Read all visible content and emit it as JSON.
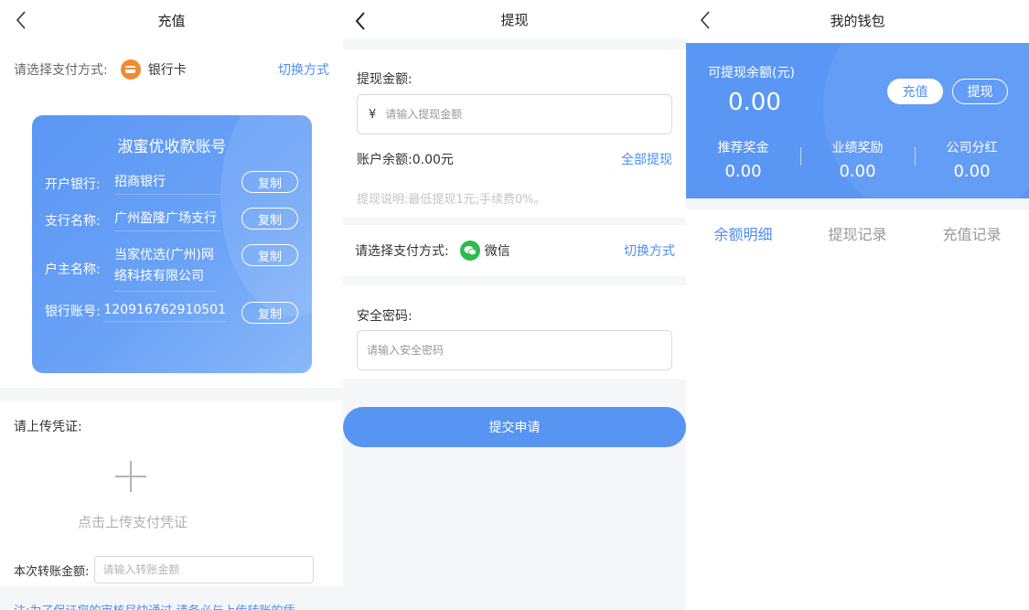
{
  "recharge": {
    "title": "充值",
    "pay_label": "请选择支付方式:",
    "pay_method": "银行卡",
    "switch_label": "切换方式",
    "card": {
      "title": "淑蜜优收款账号",
      "copy_label": "复制",
      "rows": [
        {
          "key": "开户银行:",
          "value": "招商银行"
        },
        {
          "key": "支行名称:",
          "value": "广州盈隆广场支行"
        },
        {
          "key": "户主名称:",
          "value": "当家优选(广州)网络科技有限公司"
        },
        {
          "key": "银行账号:",
          "value": "120916762910501"
        }
      ]
    },
    "upload_label": "请上传凭证:",
    "upload_hint": "点击上传支付凭证",
    "amount_label": "本次转账金额:",
    "amount_placeholder": "请输入转账金额",
    "note": "注:为了保证您的审核尽快通过,请务必与上传转账的凭"
  },
  "withdraw": {
    "title": "提现",
    "amount_label": "提现金额:",
    "currency_symbol": "¥",
    "amount_placeholder": "请输入提现金额",
    "balance_text": "账户余额:0.00元",
    "withdraw_all": "全部提现",
    "note": "提现说明:最低提现1元;手续费0%。",
    "pay_label": "请选择支付方式:",
    "pay_method": "微信",
    "switch_label": "切换方式",
    "password_label": "安全密码:",
    "password_placeholder": "请输入安全密码",
    "submit_label": "提交申请"
  },
  "wallet": {
    "title": "我的钱包",
    "balance_label": "可提现余额(元)",
    "balance_value": "0.00",
    "recharge_btn": "充值",
    "withdraw_btn": "提现",
    "stats": [
      {
        "label": "推荐奖金",
        "value": "0.00"
      },
      {
        "label": "业绩奖励",
        "value": "0.00"
      },
      {
        "label": "公司分红",
        "value": "0.00"
      }
    ],
    "tabs": [
      "余额明细",
      "提现记录",
      "充值记录"
    ]
  },
  "colors": {
    "accent": "#4d8ff0",
    "card_blue": "#5a97f5",
    "bank_icon": "#f08c2e",
    "wechat_green": "#2dbb4d"
  }
}
